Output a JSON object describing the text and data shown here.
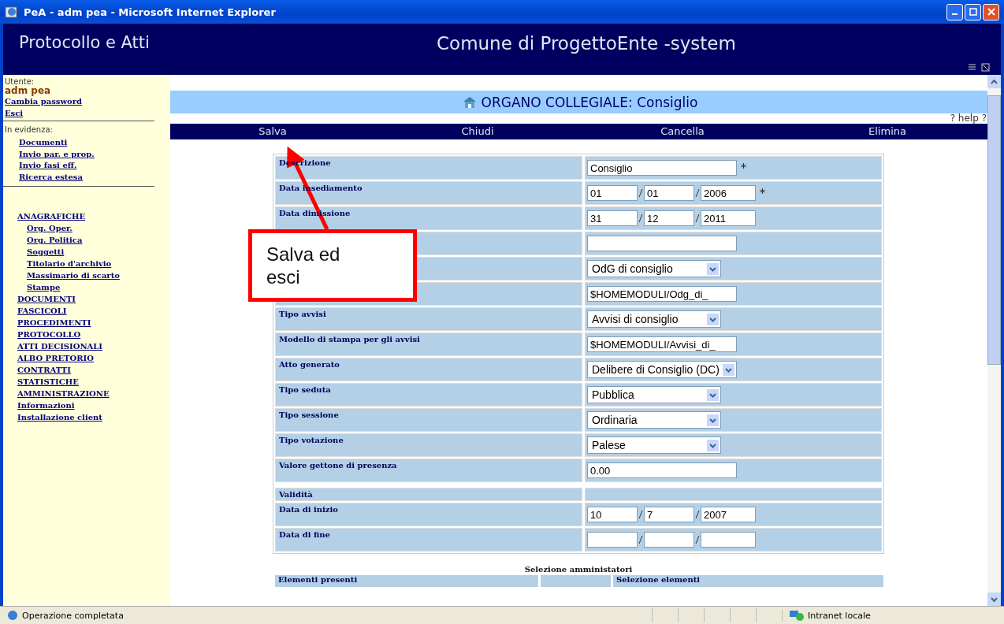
{
  "window": {
    "title": "PeA - adm pea - Microsoft Internet Explorer"
  },
  "header": {
    "app_title": "Protocollo e Atti",
    "site_title": "Comune di ProgettoEnte -system"
  },
  "sidebar": {
    "user_label": "Utente:",
    "user_name": "adm pea",
    "user_links": [
      "Cambia password",
      "Esci"
    ],
    "highlight_label": "In evidenza:",
    "highlight_links": [
      "Documenti",
      "Invio par. e prop.",
      "Invio fasi eff.",
      "Ricerca estesa"
    ],
    "menu": [
      {
        "label": "ANAGRAFICHE",
        "children": [
          {
            "label": "Org. Oper."
          },
          {
            "label": "Org. Politica"
          },
          {
            "label": "Soggetti"
          },
          {
            "label": "Titolario d'archivio"
          },
          {
            "label": "Massimario di scarto"
          },
          {
            "label": "Stampe"
          }
        ]
      },
      {
        "label": "DOCUMENTI"
      },
      {
        "label": "FASCICOLI"
      },
      {
        "label": "PROCEDIMENTI"
      },
      {
        "label": "PROTOCOLLO"
      },
      {
        "label": "ATTI DECISIONALI"
      },
      {
        "label": "ALBO PRETORIO"
      },
      {
        "label": "CONTRATTI"
      },
      {
        "label": "STATISTICHE"
      },
      {
        "label": "AMMINISTRAZIONE"
      },
      {
        "label": "Informazioni"
      },
      {
        "label": "Installazione client"
      }
    ]
  },
  "page": {
    "title": "ORGANO COLLEGIALE: Consiglio",
    "help": "? help ?",
    "actions": [
      "Salva",
      "Chiudi",
      "Cancella",
      "Elimina"
    ]
  },
  "form": [
    {
      "kind": "text",
      "label": "Descrizione",
      "value": "Consiglio",
      "required": true
    },
    {
      "kind": "date",
      "label": "Data insediamento",
      "day": "01",
      "month": "01",
      "year": "2006",
      "required": true
    },
    {
      "kind": "date",
      "label": "Data dimissione",
      "day": "31",
      "month": "12",
      "year": "2011"
    },
    {
      "kind": "text"
    },
    {
      "kind": "select",
      "value": "OdG di consiglio"
    },
    {
      "kind": "text",
      "value": "$HOMEMODULI/Odg_di_"
    },
    {
      "kind": "select",
      "label": "Tipo avvisi",
      "value": "Avvisi di consiglio"
    },
    {
      "kind": "text",
      "label": "Modello di stampa per gli avvisi",
      "value": "$HOMEMODULI/Avvisi_di_"
    },
    {
      "kind": "select",
      "label": "Atto generato",
      "value": "Delibere di Consiglio (DC)"
    },
    {
      "kind": "select",
      "label": "Tipo seduta",
      "value": "Pubblica"
    },
    {
      "kind": "select",
      "label": "Tipo sessione",
      "value": "Ordinaria"
    },
    {
      "kind": "select",
      "label": "Tipo votazione",
      "value": "Palese"
    },
    {
      "kind": "text",
      "label": "Valore gettone di presenza",
      "value": "0.00"
    },
    {
      "kind": "section",
      "label": "Validità"
    },
    {
      "kind": "date",
      "label": "Data di inizio",
      "day": "10",
      "month": "7",
      "year": "2007"
    },
    {
      "kind": "date",
      "label": "Data di fine"
    }
  ],
  "admin_selection": {
    "title": "Selezione amministatori",
    "columns": [
      "Elementi presenti",
      "Selezione elementi"
    ]
  },
  "callout": {
    "text": "Salva ed esci"
  },
  "status_bar": {
    "message": "Operazione completata",
    "zone": "Intranet locale"
  }
}
